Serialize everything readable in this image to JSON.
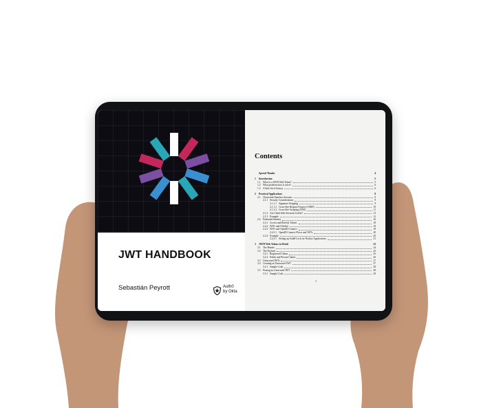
{
  "cover": {
    "title": "JWT HANDBOOK",
    "author": "Sebastián Peyrott",
    "publisher": "Auth0\nby Okta"
  },
  "toc": {
    "heading": "Contents",
    "page_number": "1",
    "entries": [
      {
        "num": "",
        "label": "Special Thanks",
        "page": "4",
        "level": 0,
        "bold": true
      },
      {
        "num": "1",
        "label": "Introduction",
        "page": "5",
        "level": 0,
        "bold": true
      },
      {
        "num": "1.1",
        "label": "What is a JSON Web Token?",
        "page": "5",
        "level": 1
      },
      {
        "num": "1.2",
        "label": "What problem does it solve?",
        "page": "6",
        "level": 1
      },
      {
        "num": "1.3",
        "label": "A little bit of history",
        "page": "6",
        "level": 1
      },
      {
        "num": "2",
        "label": "Practical Applications",
        "page": "8",
        "level": 0,
        "bold": true
      },
      {
        "num": "2.1",
        "label": "Client-side/Stateless Sessions",
        "page": "8",
        "level": 1
      },
      {
        "num": "2.1.1",
        "label": "Security Considerations",
        "page": "9",
        "level": 2
      },
      {
        "num": "2.1.1.1",
        "label": "Signature Stripping",
        "page": "9",
        "level": 3
      },
      {
        "num": "2.1.1.2",
        "label": "Cross-Site Request Forgery (CSRF)",
        "page": "10",
        "level": 3
      },
      {
        "num": "2.1.1.3",
        "label": "Cross-Site Scripting (XSS)",
        "page": "11",
        "level": 3
      },
      {
        "num": "2.1.2",
        "label": "Are Client-Side Sessions Useful?",
        "page": "13",
        "level": 2
      },
      {
        "num": "2.1.3",
        "label": "Example",
        "page": "13",
        "level": 2
      },
      {
        "num": "2.2",
        "label": "Federated Identity",
        "page": "16",
        "level": 1
      },
      {
        "num": "2.2.1",
        "label": "Access and Refresh Tokens",
        "page": "18",
        "level": 2
      },
      {
        "num": "2.2.2",
        "label": "JWTs and OAuth2",
        "page": "19",
        "level": 2
      },
      {
        "num": "2.2.3",
        "label": "JWTs and OpenID Connect",
        "page": "19",
        "level": 2
      },
      {
        "num": "2.2.3.1",
        "label": "OpenID Connect Flows and JWTs",
        "page": "20",
        "level": 3
      },
      {
        "num": "2.2.4",
        "label": "Example",
        "page": "20",
        "level": 2
      },
      {
        "num": "2.2.4.1",
        "label": "Setting up Auth0 Lock for Node.js Applications",
        "page": "21",
        "level": 3
      },
      {
        "num": "3",
        "label": "JSON Web Tokens in Detail",
        "page": "23",
        "level": 0,
        "bold": true
      },
      {
        "num": "3.1",
        "label": "The Header",
        "page": "24",
        "level": 1
      },
      {
        "num": "3.2",
        "label": "The Payload",
        "page": "25",
        "level": 1
      },
      {
        "num": "3.2.1",
        "label": "Registered Claims",
        "page": "25",
        "level": 2
      },
      {
        "num": "3.2.2",
        "label": "Public and Private Claims",
        "page": "26",
        "level": 2
      },
      {
        "num": "3.3",
        "label": "Unsecured JWTs",
        "page": "27",
        "level": 1
      },
      {
        "num": "3.4",
        "label": "Creating an Unsecured JWT",
        "page": "27",
        "level": 1
      },
      {
        "num": "3.4.1",
        "label": "Sample Code",
        "page": "28",
        "level": 2
      },
      {
        "num": "3.5",
        "label": "Parsing an Unsecured JWT",
        "page": "28",
        "level": 1
      },
      {
        "num": "3.5.1",
        "label": "Sample Code",
        "page": "29",
        "level": 2
      }
    ]
  },
  "colors": {
    "cover_dark": "#0c0c12",
    "logo_white": "#ffffff",
    "logo_teal": "#2aa7b6",
    "logo_blue": "#3a8fd0",
    "logo_purple": "#7b4fa2",
    "logo_magenta": "#c4285a",
    "tablet_frame": "#111214",
    "skin": "#c79b7e"
  }
}
